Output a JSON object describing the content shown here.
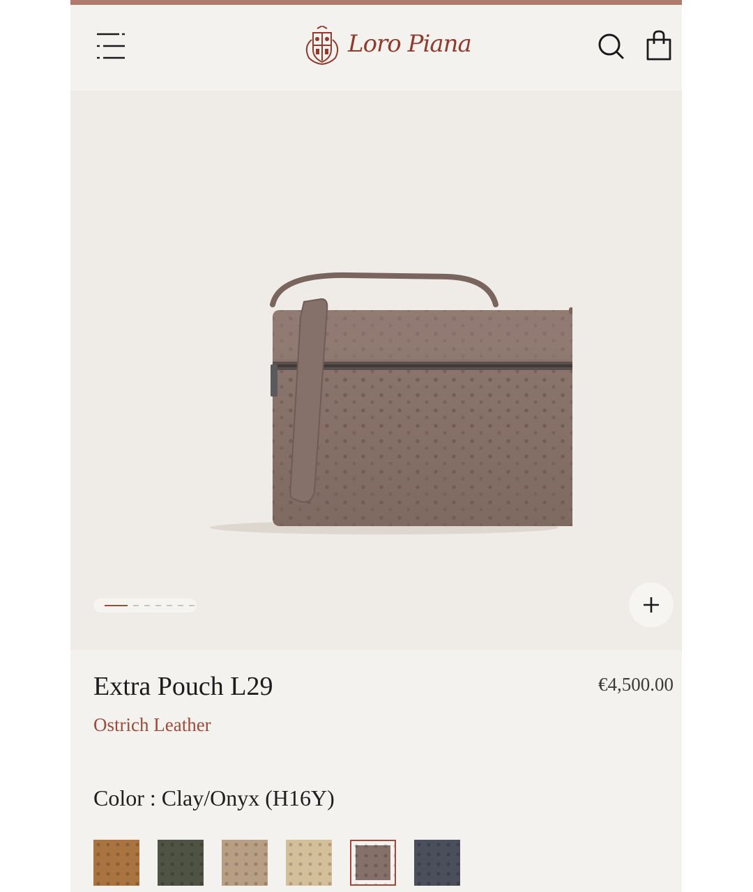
{
  "brand": {
    "name": "Loro Piana",
    "accent_color": "#a0483a"
  },
  "header": {
    "menu_icon": "menu-icon",
    "search_icon": "search-icon",
    "bag_icon": "shopping-bag-icon"
  },
  "gallery": {
    "image_alt": "Extra Pouch L29 in Clay/Onyx ostrich leather",
    "image_count": 7,
    "active_index": 1,
    "zoom_icon": "plus-icon"
  },
  "product": {
    "title": "Extra Pouch L29",
    "price": "€4,500.00",
    "material": "Ostrich Leather",
    "color_line": "Color : Clay/Onyx (H16Y)"
  },
  "swatches": [
    {
      "color": "#a97440",
      "selected": false
    },
    {
      "color": "#4e5343",
      "selected": false
    },
    {
      "color": "#b89f83",
      "selected": false
    },
    {
      "color": "#d4bf9b",
      "selected": false
    },
    {
      "color": "#86706a",
      "selected": true
    },
    {
      "color": "#4b4e5b",
      "selected": false
    }
  ]
}
